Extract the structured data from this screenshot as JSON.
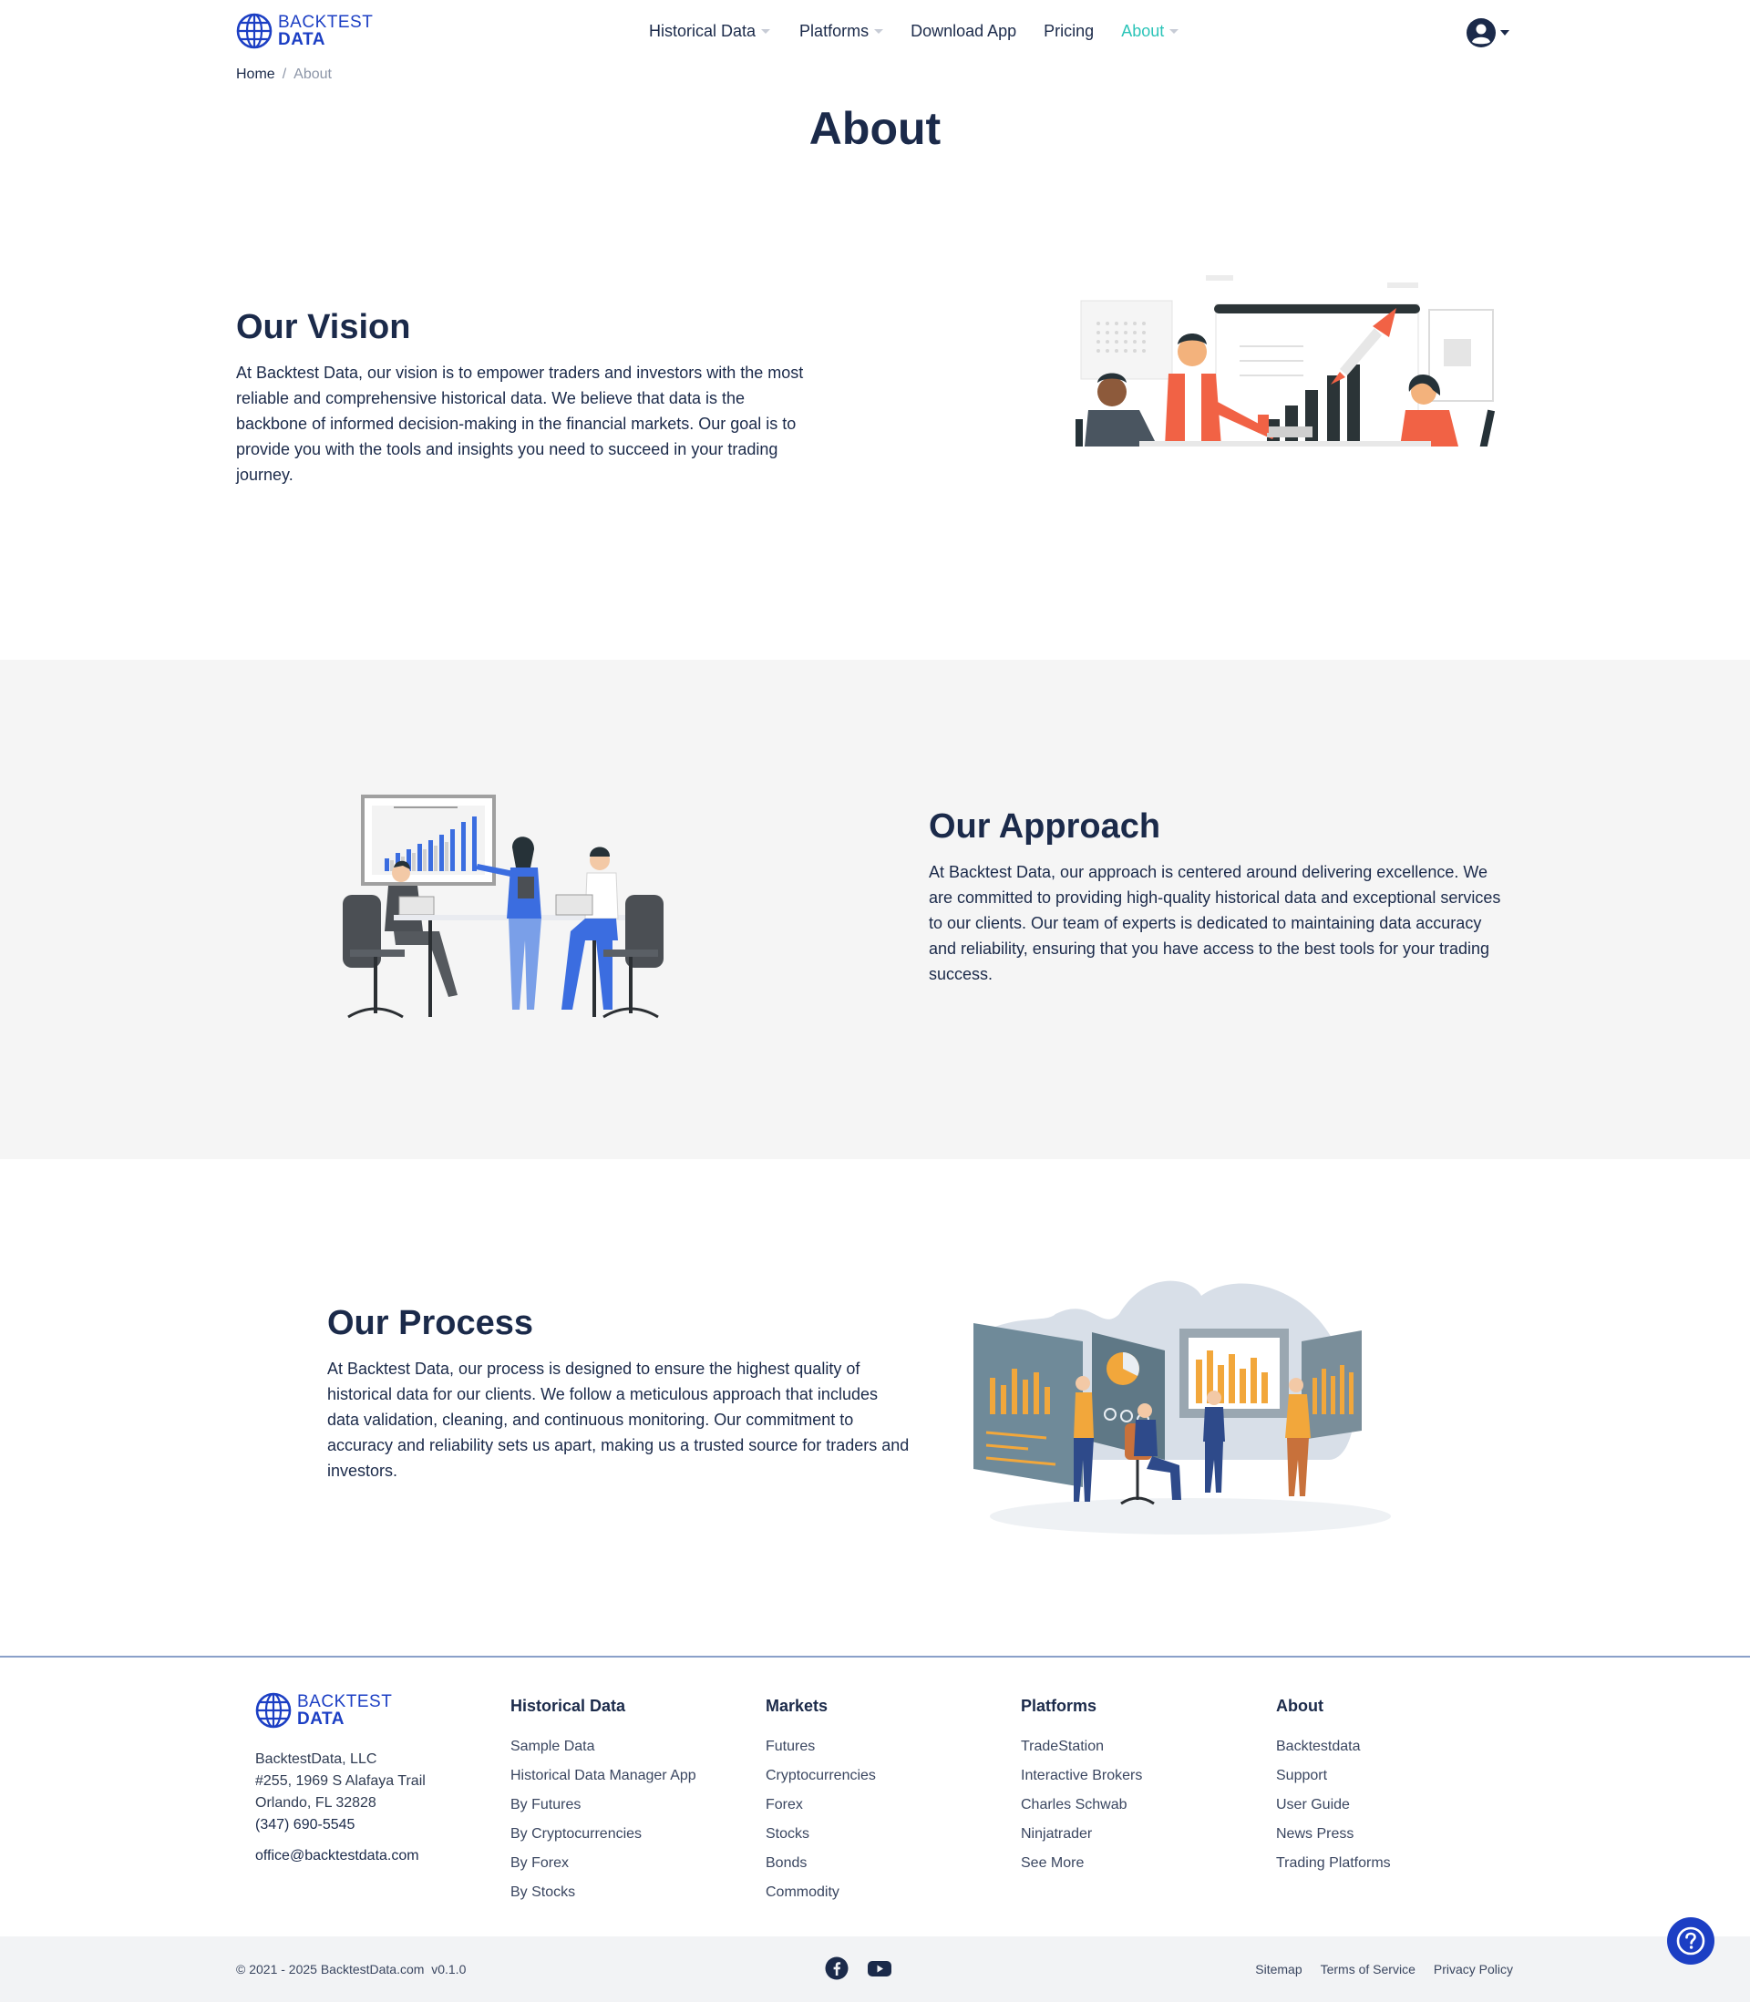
{
  "brand": {
    "line1": "BACKTEST",
    "line2": "DATA",
    "color": "#1c3fc4"
  },
  "nav": {
    "items": [
      {
        "label": "Historical Data",
        "has_dropdown": true
      },
      {
        "label": "Platforms",
        "has_dropdown": true
      },
      {
        "label": "Download App",
        "has_dropdown": false
      },
      {
        "label": "Pricing",
        "has_dropdown": false
      },
      {
        "label": "About",
        "has_dropdown": true,
        "active": true
      }
    ],
    "active_color": "#2bc4b8",
    "user_icon": "user-circle-icon"
  },
  "breadcrumb": {
    "home": "Home",
    "separator": "/",
    "current": "About"
  },
  "page_title": "About",
  "sections": {
    "vision": {
      "title": "Our Vision",
      "body": "At Backtest Data, our vision is to empower traders and investors with the most reliable and comprehensive historical data. We believe that data is the backbone of informed decision-making in the financial markets. Our goal is to provide you with the tools and insights you need to succeed in your trading journey."
    },
    "approach": {
      "title": "Our Approach",
      "body": "At Backtest Data, our approach is centered around delivering excellence. We are committed to providing high-quality historical data and exceptional services to our clients. Our team of experts is dedicated to maintaining data accuracy and reliability, ensuring that you have access to the best tools for your trading success."
    },
    "process": {
      "title": "Our Process",
      "body": "At Backtest Data, our process is designed to ensure the highest quality of historical data for our clients. We follow a meticulous approach that includes data validation, cleaning, and continuous monitoring. Our commitment to accuracy and reliability sets us apart, making us a trusted source for traders and investors."
    }
  },
  "footer": {
    "company": "BacktestData, LLC",
    "address1": "#255, 1969 S Alafaya Trail",
    "address2": "Orlando, FL 32828",
    "phone": "(347) 690-5545",
    "email": "office@backtestdata.com",
    "columns": [
      {
        "title": "Historical Data",
        "links": [
          "Sample Data",
          "Historical Data Manager App",
          "By Futures",
          "By Cryptocurrencies",
          "By Forex",
          "By Stocks"
        ]
      },
      {
        "title": "Markets",
        "links": [
          "Futures",
          "Cryptocurrencies",
          "Forex",
          "Stocks",
          "Bonds",
          "Commodity"
        ]
      },
      {
        "title": "Platforms",
        "links": [
          "TradeStation",
          "Interactive Brokers",
          "Charles Schwab",
          "Ninjatrader",
          "See More"
        ]
      },
      {
        "title": "About",
        "links": [
          "Backtestdata",
          "Support",
          "User Guide",
          "News Press",
          "Trading Platforms"
        ]
      }
    ],
    "copyright": "© 2021 - 2025 BacktestData.com",
    "version": "v0.1.0",
    "social_icons": [
      "facebook-icon",
      "youtube-icon"
    ],
    "legal": [
      "Sitemap",
      "Terms of Service",
      "Privacy Policy"
    ]
  },
  "help_icon": "question-circle-icon"
}
